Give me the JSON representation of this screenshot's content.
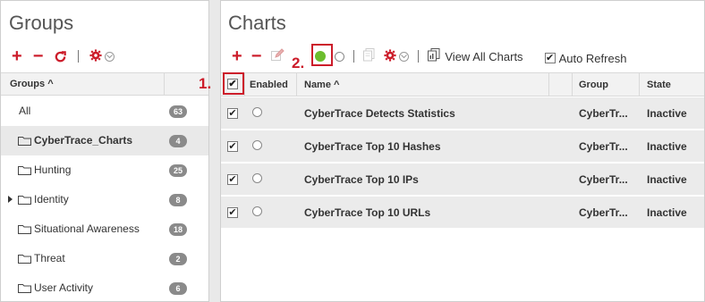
{
  "groups_panel": {
    "title": "Groups",
    "column_header": "Groups",
    "sort_indicator": "^",
    "items": [
      {
        "label": "All",
        "count": "63",
        "has_folder": false,
        "has_caret": false,
        "selected": false
      },
      {
        "label": "CyberTrace_Charts",
        "count": "4",
        "has_folder": true,
        "has_caret": false,
        "selected": true
      },
      {
        "label": "Hunting",
        "count": "25",
        "has_folder": true,
        "has_caret": false,
        "selected": false
      },
      {
        "label": "Identity",
        "count": "8",
        "has_folder": true,
        "has_caret": true,
        "selected": false
      },
      {
        "label": "Situational Awareness",
        "count": "18",
        "has_folder": true,
        "has_caret": false,
        "selected": false
      },
      {
        "label": "Threat",
        "count": "2",
        "has_folder": true,
        "has_caret": false,
        "selected": false
      },
      {
        "label": "User Activity",
        "count": "6",
        "has_folder": true,
        "has_caret": false,
        "selected": false
      }
    ]
  },
  "charts_panel": {
    "title": "Charts",
    "toolbar": {
      "view_all_label": "View All Charts",
      "auto_refresh_label": "Auto Refresh",
      "auto_refresh_checked": true
    },
    "annotations": {
      "step1": "1.",
      "step2": "2."
    },
    "columns": {
      "enabled": "Enabled",
      "name": "Name",
      "name_sort": "^",
      "group": "Group",
      "state": "State"
    },
    "rows": [
      {
        "checked": true,
        "name": "CyberTrace Detects Statistics",
        "group": "CyberTr...",
        "state": "Inactive"
      },
      {
        "checked": true,
        "name": "CyberTrace Top 10 Hashes",
        "group": "CyberTr...",
        "state": "Inactive"
      },
      {
        "checked": true,
        "name": "CyberTrace Top 10 IPs",
        "group": "CyberTr...",
        "state": "Inactive"
      },
      {
        "checked": true,
        "name": "CyberTrace Top 10 URLs",
        "group": "CyberTr...",
        "state": "Inactive"
      }
    ]
  },
  "colors": {
    "accent_red": "#cc1c2a",
    "enable_green": "#6cbd2d",
    "badge_gray": "#8a8a8a"
  }
}
